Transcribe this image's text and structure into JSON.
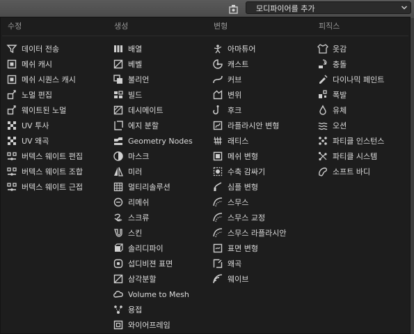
{
  "header": {
    "add_modifier_label": "모디파이어를 추가",
    "property_icon": "wrench-tab-icon",
    "dropdown_icon": "chevron-down-icon"
  },
  "columns": [
    {
      "title": "수정",
      "items": [
        {
          "label": "데이터 전송",
          "icon": "data-transfer-icon"
        },
        {
          "label": "메쉬 캐시",
          "icon": "mesh-cache-icon"
        },
        {
          "label": "메쉬 시퀀스 캐시",
          "icon": "mesh-sequence-cache-icon"
        },
        {
          "label": "노멀 편집",
          "icon": "normal-edit-icon"
        },
        {
          "label": "웨이트된 노멀",
          "icon": "weighted-normal-icon"
        },
        {
          "label": "UV 투사",
          "icon": "uv-project-icon"
        },
        {
          "label": "UV 왜곡",
          "icon": "uv-warp-icon"
        },
        {
          "label": "버텍스 웨이트 편집",
          "icon": "vertex-weight-edit-icon"
        },
        {
          "label": "버텍스 웨이트 조합",
          "icon": "vertex-weight-mix-icon"
        },
        {
          "label": "버텍스 웨이트 근접",
          "icon": "vertex-weight-proximity-icon"
        }
      ]
    },
    {
      "title": "생성",
      "items": [
        {
          "label": "배열",
          "icon": "array-icon"
        },
        {
          "label": "베벨",
          "icon": "bevel-icon"
        },
        {
          "label": "불리언",
          "icon": "boolean-icon"
        },
        {
          "label": "빌드",
          "icon": "build-icon"
        },
        {
          "label": "데시메이트",
          "icon": "decimate-icon"
        },
        {
          "label": "에지 분할",
          "icon": "edge-split-icon"
        },
        {
          "label": "Geometry Nodes",
          "icon": "geometry-nodes-icon"
        },
        {
          "label": "마스크",
          "icon": "mask-icon"
        },
        {
          "label": "미러",
          "icon": "mirror-icon"
        },
        {
          "label": "멀티리솔루션",
          "icon": "multiresolution-icon"
        },
        {
          "label": "리메쉬",
          "icon": "remesh-icon"
        },
        {
          "label": "스크류",
          "icon": "screw-icon"
        },
        {
          "label": "스킨",
          "icon": "skin-icon"
        },
        {
          "label": "솔리디파이",
          "icon": "solidify-icon"
        },
        {
          "label": "섭디비젼 표면",
          "icon": "subdivision-surface-icon"
        },
        {
          "label": "삼각분할",
          "icon": "triangulate-icon"
        },
        {
          "label": "Volume to Mesh",
          "icon": "volume-to-mesh-icon"
        },
        {
          "label": "용접",
          "icon": "weld-icon"
        },
        {
          "label": "와이어프레임",
          "icon": "wireframe-icon"
        }
      ]
    },
    {
      "title": "변형",
      "items": [
        {
          "label": "아마튜어",
          "icon": "armature-icon"
        },
        {
          "label": "캐스트",
          "icon": "cast-icon"
        },
        {
          "label": "커브",
          "icon": "curve-icon"
        },
        {
          "label": "변위",
          "icon": "displace-icon"
        },
        {
          "label": "후크",
          "icon": "hook-icon"
        },
        {
          "label": "라플라시안 변형",
          "icon": "laplacian-deform-icon"
        },
        {
          "label": "래티스",
          "icon": "lattice-icon"
        },
        {
          "label": "메쉬 변형",
          "icon": "mesh-deform-icon"
        },
        {
          "label": "수축 감싸기",
          "icon": "shrinkwrap-icon"
        },
        {
          "label": "심플 변형",
          "icon": "simple-deform-icon"
        },
        {
          "label": "스무스",
          "icon": "smooth-icon"
        },
        {
          "label": "스무스 교정",
          "icon": "smooth-corrective-icon"
        },
        {
          "label": "스무스 라플라시안",
          "icon": "smooth-laplacian-icon"
        },
        {
          "label": "표면 변형",
          "icon": "surface-deform-icon"
        },
        {
          "label": "왜곡",
          "icon": "warp-icon"
        },
        {
          "label": "웨이브",
          "icon": "wave-icon"
        }
      ]
    },
    {
      "title": "피직스",
      "items": [
        {
          "label": "옷감",
          "icon": "cloth-icon"
        },
        {
          "label": "충돌",
          "icon": "collision-icon"
        },
        {
          "label": "다이나믹 페인트",
          "icon": "dynamic-paint-icon"
        },
        {
          "label": "폭발",
          "icon": "explode-icon"
        },
        {
          "label": "유체",
          "icon": "fluid-icon"
        },
        {
          "label": "오션",
          "icon": "ocean-icon"
        },
        {
          "label": "파티클 인스턴스",
          "icon": "particle-instance-icon"
        },
        {
          "label": "파티클 시스템",
          "icon": "particle-system-icon"
        },
        {
          "label": "소프트 바디",
          "icon": "soft-body-icon"
        }
      ]
    }
  ]
}
